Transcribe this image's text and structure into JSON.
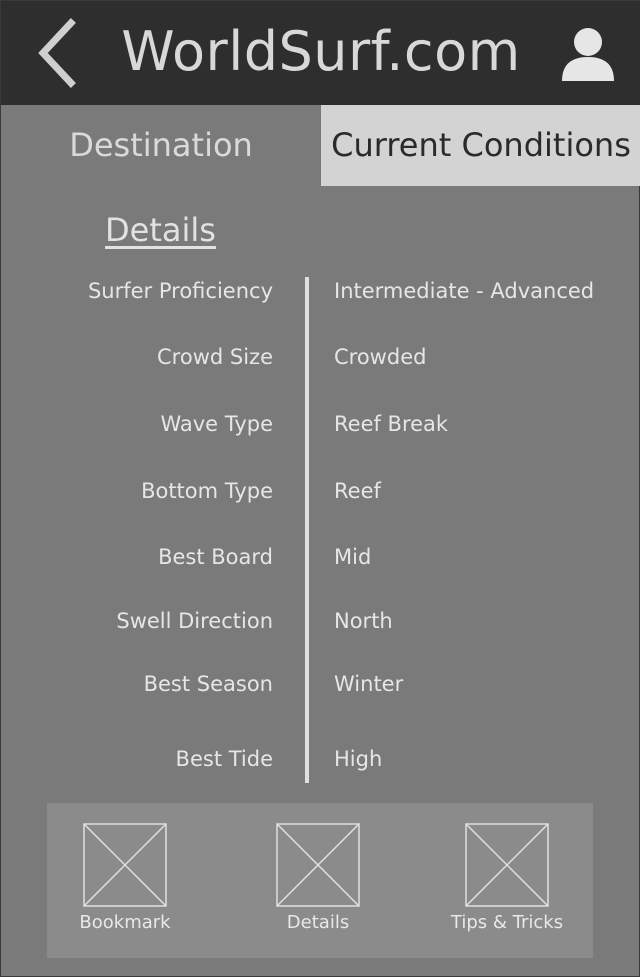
{
  "header": {
    "title": "WorldSurf.com",
    "back_icon": "chevron-left-icon",
    "user_icon": "user-icon"
  },
  "tabs": [
    {
      "label": "Destination",
      "active": false
    },
    {
      "label": "Current Conditions",
      "active": true
    }
  ],
  "details": {
    "title": "Details",
    "rows": [
      {
        "label": "Surfer Proficiency",
        "value": "Intermediate - Advanced"
      },
      {
        "label": "Crowd Size",
        "value": "Crowded"
      },
      {
        "label": "Wave Type",
        "value": "Reef Break"
      },
      {
        "label": "Bottom Type",
        "value": "Reef"
      },
      {
        "label": "Best Board",
        "value": "Mid"
      },
      {
        "label": "Swell Direction",
        "value": "North"
      },
      {
        "label": "Best Season",
        "value": "Winter"
      },
      {
        "label": "Best Tide",
        "value": "High"
      }
    ]
  },
  "bottom_nav": [
    {
      "label": "Bookmark",
      "icon": "image-placeholder-icon"
    },
    {
      "label": "Details",
      "icon": "image-placeholder-icon"
    },
    {
      "label": "Tips & Tricks",
      "icon": "image-placeholder-icon"
    }
  ],
  "colors": {
    "header_bg": "#2e2e2e",
    "body_bg": "#7a7a7a",
    "active_tab_bg": "#d3d3d3",
    "nav_bg": "#8b8b8b",
    "text": "#e6e6e6"
  }
}
